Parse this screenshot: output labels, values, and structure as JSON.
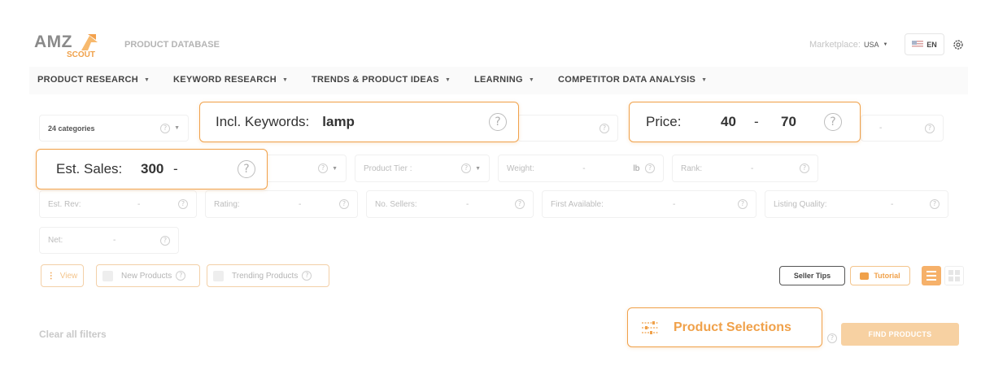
{
  "brand": {
    "logo_top": "AMZ",
    "logo_bottom": "SCOUT",
    "title": "PRODUCT DATABASE"
  },
  "header": {
    "marketplace_label": "Marketplace:",
    "marketplace_value": "USA",
    "language": "EN"
  },
  "nav": [
    {
      "label": "PRODUCT RESEARCH"
    },
    {
      "label": "KEYWORD RESEARCH"
    },
    {
      "label": "TRENDS & PRODUCT IDEAS"
    },
    {
      "label": "LEARNING"
    },
    {
      "label": "COMPETITOR DATA ANALYSIS"
    }
  ],
  "filters": {
    "categories": "24  categories",
    "product_tier": "Product Tier :",
    "weight": {
      "label": "Weight:",
      "sep": "-",
      "unit": "lb"
    },
    "rank": {
      "label": "Rank:",
      "sep": "-"
    },
    "est_rev": {
      "label": "Est. Rev:",
      "sep": "-"
    },
    "rating": {
      "label": "Rating:",
      "sep": "-"
    },
    "sellers": {
      "label": "No. Sellers:",
      "sep": "-"
    },
    "first_available": {
      "label": "First Available:",
      "sep": "-"
    },
    "listing_quality": {
      "label": "Listing Quality:",
      "sep": "-"
    },
    "net": {
      "label": "Net:",
      "sep": "-"
    },
    "right_row1_sep": "-"
  },
  "callouts": {
    "keywords": {
      "label": "Incl. Keywords:",
      "value": "lamp"
    },
    "price": {
      "label": "Price:",
      "min": "40",
      "sep": "-",
      "max": "70"
    },
    "sales": {
      "label": "Est. Sales:",
      "min": "300",
      "sep": "-"
    },
    "selections": {
      "label": "Product Selections"
    }
  },
  "options": {
    "view": "View",
    "new_products": "New Products",
    "trending_products": "Trending Products"
  },
  "actions": {
    "seller_tips": "Seller Tips",
    "tutorial": "Tutorial",
    "clear": "Clear all filters",
    "find": "FIND PRODUCTS"
  },
  "colors": {
    "accent": "#f0a14a",
    "accent_light": "#f7cc95",
    "nav_bg": "#fafafa"
  }
}
